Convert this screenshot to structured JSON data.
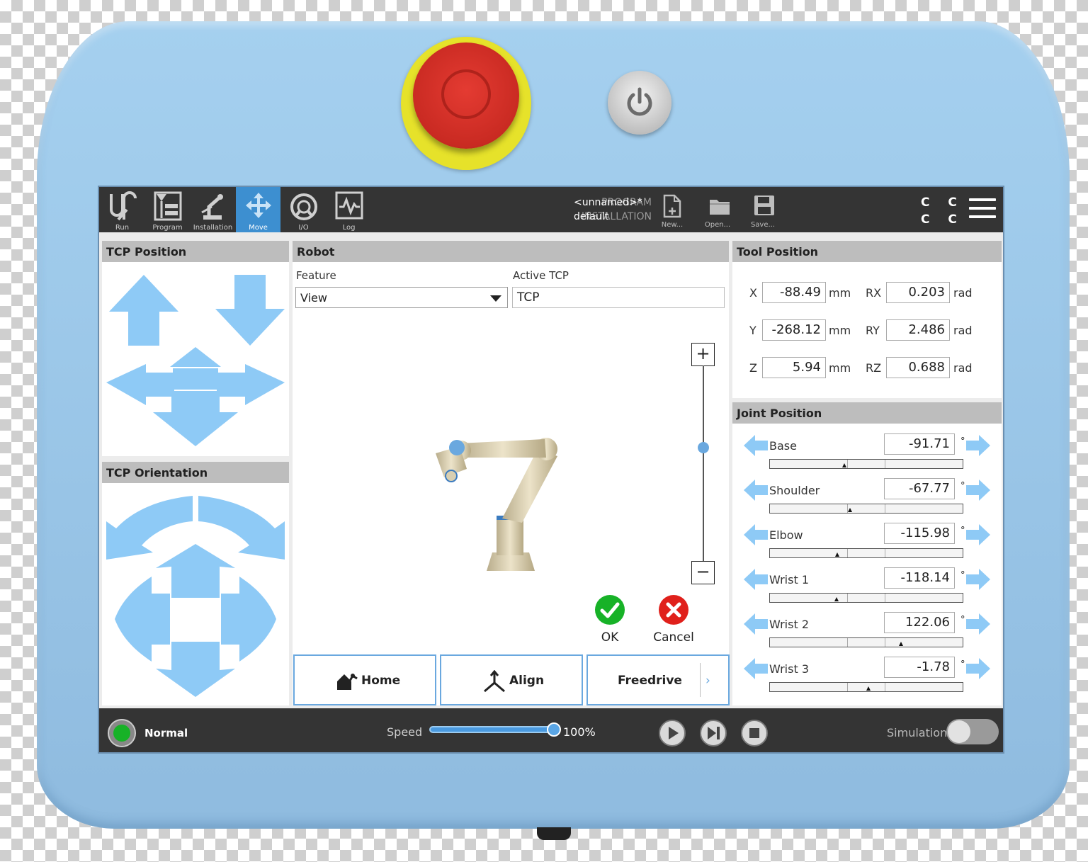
{
  "nav": [
    {
      "label": "Run",
      "icon": "ur-logo-icon"
    },
    {
      "label": "Program",
      "icon": "program-icon"
    },
    {
      "label": "Installation",
      "icon": "installation-icon"
    },
    {
      "label": "Move",
      "icon": "move-icon",
      "active": true
    },
    {
      "label": "I/O",
      "icon": "io-icon"
    },
    {
      "label": "Log",
      "icon": "log-icon"
    }
  ],
  "program": {
    "program_label": "PROGRAM",
    "program_value": "<unnamed>*",
    "installation_label": "INSTALLATION",
    "installation_value": "default"
  },
  "file_buttons": {
    "new": "New...",
    "open": "Open...",
    "save": "Save..."
  },
  "header_cc": {
    "line1": "C C",
    "line2": "C C"
  },
  "tcp_position": {
    "title": "TCP Position"
  },
  "tcp_orientation": {
    "title": "TCP Orientation"
  },
  "robot": {
    "title": "Robot",
    "feature_label": "Feature",
    "feature_value": "View",
    "active_tcp_label": "Active TCP",
    "active_tcp_value": "TCP",
    "zoom_in": "+",
    "zoom_out": "−",
    "zoom_level": 0.58,
    "ok": "OK",
    "cancel": "Cancel",
    "home": "Home",
    "align": "Align",
    "freedrive": "Freedrive",
    "more": "›"
  },
  "tool_position": {
    "title": "Tool Position",
    "rows": [
      {
        "axis": "X",
        "value": "-88.49",
        "unit": "mm",
        "raxis": "RX",
        "rvalue": "0.203",
        "runit": "rad"
      },
      {
        "axis": "Y",
        "value": "-268.12",
        "unit": "mm",
        "raxis": "RY",
        "rvalue": "2.486",
        "runit": "rad"
      },
      {
        "axis": "Z",
        "value": "5.94",
        "unit": "mm",
        "raxis": "RZ",
        "rvalue": "0.688",
        "runit": "rad"
      }
    ]
  },
  "joint_position": {
    "title": "Joint Position",
    "unit": "°",
    "joints": [
      {
        "name": "Base",
        "value": "-91.71",
        "fraction": 0.375
      },
      {
        "name": "Shoulder",
        "value": "-67.77",
        "fraction": 0.405
      },
      {
        "name": "Elbow",
        "value": "-115.98",
        "fraction": 0.34
      },
      {
        "name": "Wrist 1",
        "value": "-118.14",
        "fraction": 0.335
      },
      {
        "name": "Wrist 2",
        "value": "122.06",
        "fraction": 0.67
      },
      {
        "name": "Wrist 3",
        "value": "-1.78",
        "fraction": 0.5
      }
    ]
  },
  "footer": {
    "status": "Normal",
    "speed_label": "Speed",
    "speed_value": "100%",
    "speed_fraction": 1.0,
    "simulation_label": "Simulation"
  },
  "colors": {
    "accent": "#3d8fd0",
    "arrow": "#8ecaf6",
    "ok": "#17b227",
    "cancel": "#e0201b",
    "estop": "#d32f26",
    "estop_ring": "#e6e22a"
  }
}
